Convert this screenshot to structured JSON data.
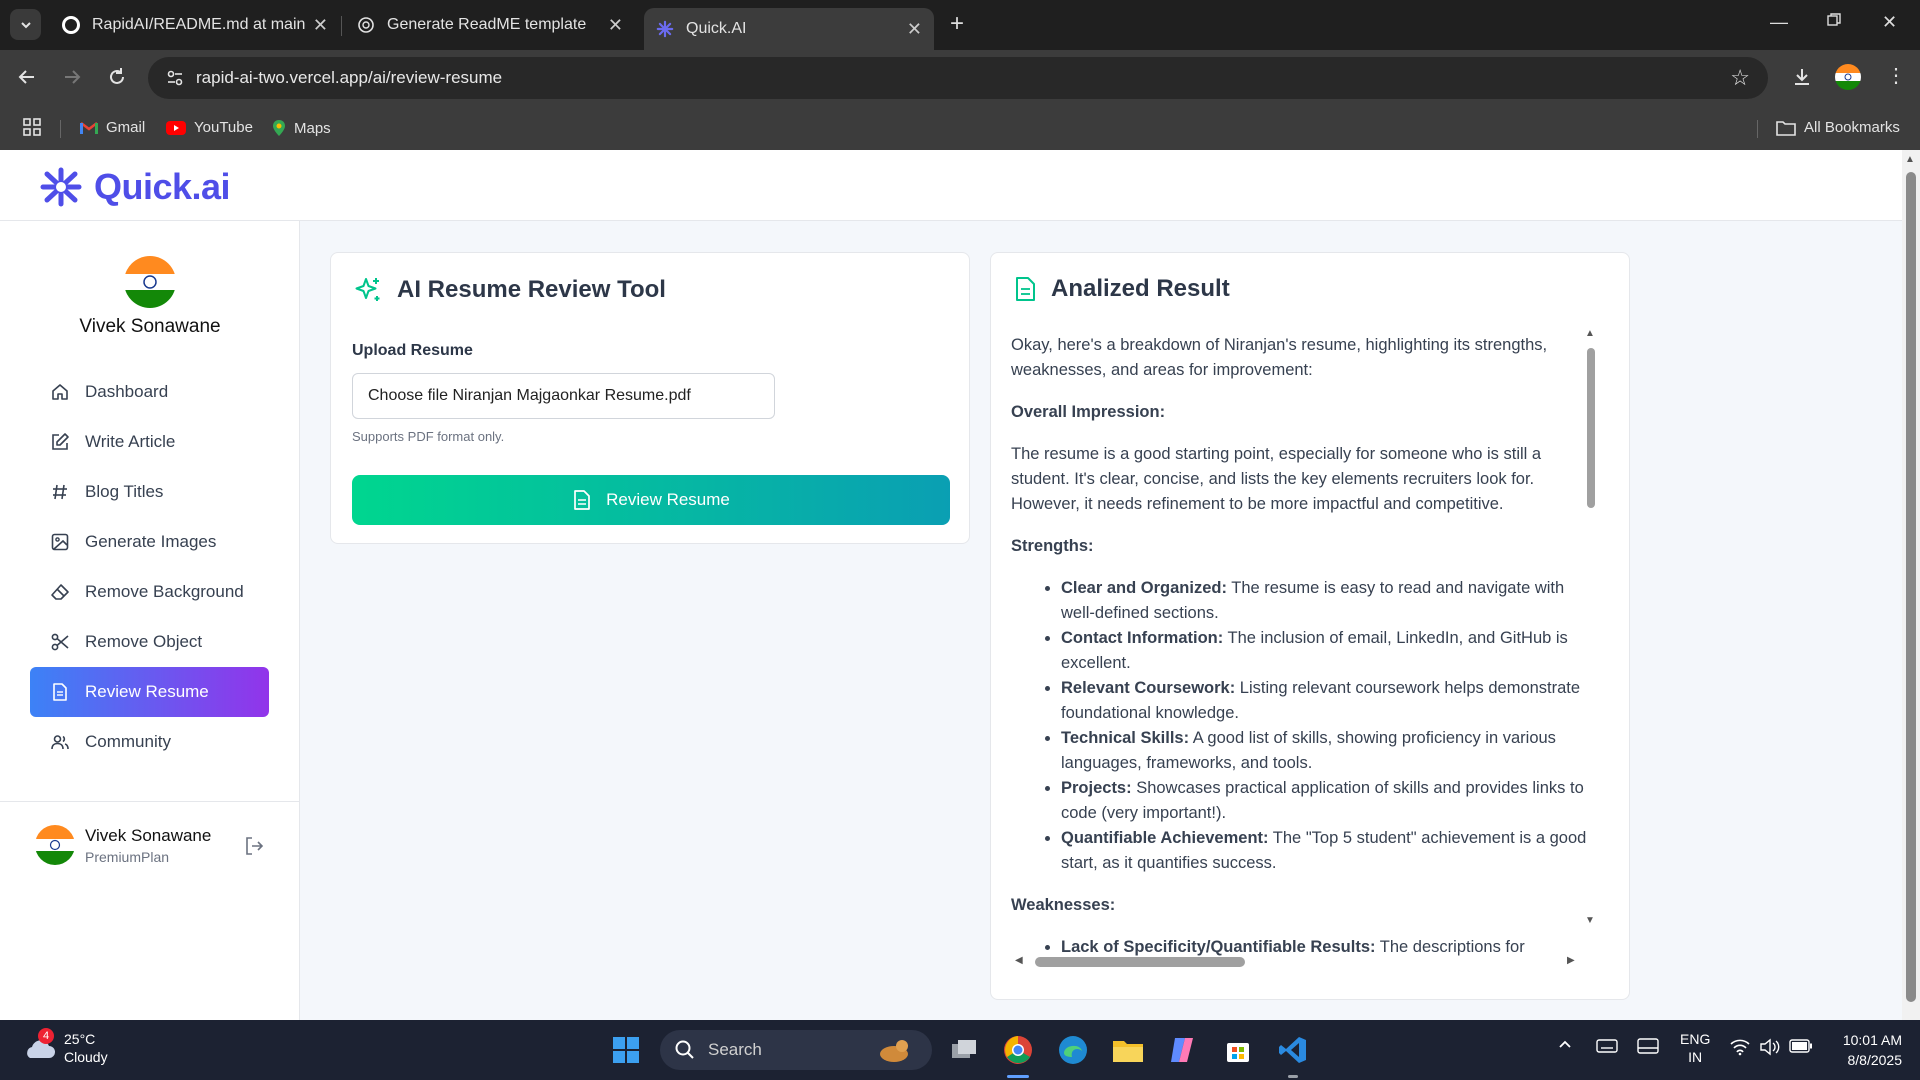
{
  "browser": {
    "tabs": [
      {
        "title": "RapidAI/README.md at main · "
      },
      {
        "title": "Generate ReadME template"
      },
      {
        "title": "Quick.AI"
      }
    ],
    "url": "rapid-ai-two.vercel.app/ai/review-resume",
    "bookmarks": [
      {
        "label": "Gmail"
      },
      {
        "label": "YouTube"
      },
      {
        "label": "Maps"
      }
    ],
    "all_bookmarks": "All Bookmarks"
  },
  "app": {
    "logo": "Quick.ai",
    "brand_color": "#4f4ee8",
    "user": {
      "name": "Vivek Sonawane",
      "plan": "PremiumPlan"
    },
    "nav": [
      {
        "label": "Dashboard",
        "icon": "home-icon"
      },
      {
        "label": "Write Article",
        "icon": "edit-icon"
      },
      {
        "label": "Blog Titles",
        "icon": "hash-icon"
      },
      {
        "label": "Generate Images",
        "icon": "image-icon"
      },
      {
        "label": "Remove Background",
        "icon": "eraser-icon"
      },
      {
        "label": "Remove Object",
        "icon": "scissors-icon"
      },
      {
        "label": "Review Resume",
        "icon": "file-text-icon",
        "active": true
      },
      {
        "label": "Community",
        "icon": "users-icon"
      }
    ]
  },
  "tool": {
    "title": "AI Resume Review Tool",
    "upload_label": "Upload Resume",
    "file_input": "Choose file Niranjan Majgaonkar Resume.pdf",
    "hint": "Supports PDF format only.",
    "button": "Review Resume"
  },
  "result": {
    "title": "Analized Result",
    "intro": "Okay, here's a breakdown of Niranjan's resume, highlighting its strengths, weaknesses, and areas for improvement:",
    "overall_heading": "Overall Impression:",
    "overall_text": "The resume is a good starting point, especially for someone who is still a student. It's clear, concise, and lists the key elements recruiters look for. However, it needs refinement to be more impactful and competitive.",
    "strengths_heading": "Strengths:",
    "strengths": [
      {
        "bold": "Clear and Organized:",
        "text": " The resume is easy to read and navigate with well-defined sections."
      },
      {
        "bold": "Contact Information:",
        "text": " The inclusion of email, LinkedIn, and GitHub is excellent."
      },
      {
        "bold": "Relevant Coursework:",
        "text": " Listing relevant coursework helps demonstrate foundational knowledge."
      },
      {
        "bold": "Technical Skills:",
        "text": " A good list of skills, showing proficiency in various languages, frameworks, and tools."
      },
      {
        "bold": "Projects:",
        "text": " Showcases practical application of skills and provides links to code (very important!)."
      },
      {
        "bold": "Quantifiable Achievement:",
        "text": " The \"Top 5 student\" achievement is a good start, as it quantifies success."
      }
    ],
    "weaknesses_heading": "Weaknesses:",
    "weaknesses": [
      {
        "bold": "Lack of Specificity/Quantifiable Results:",
        "text": " The descriptions for"
      }
    ]
  },
  "taskbar": {
    "temp": "25°C",
    "condition": "Cloudy",
    "badge": "4",
    "search": "Search",
    "lang": "ENG",
    "region": "IN",
    "time": "10:01 AM",
    "date": "8/8/2025"
  }
}
